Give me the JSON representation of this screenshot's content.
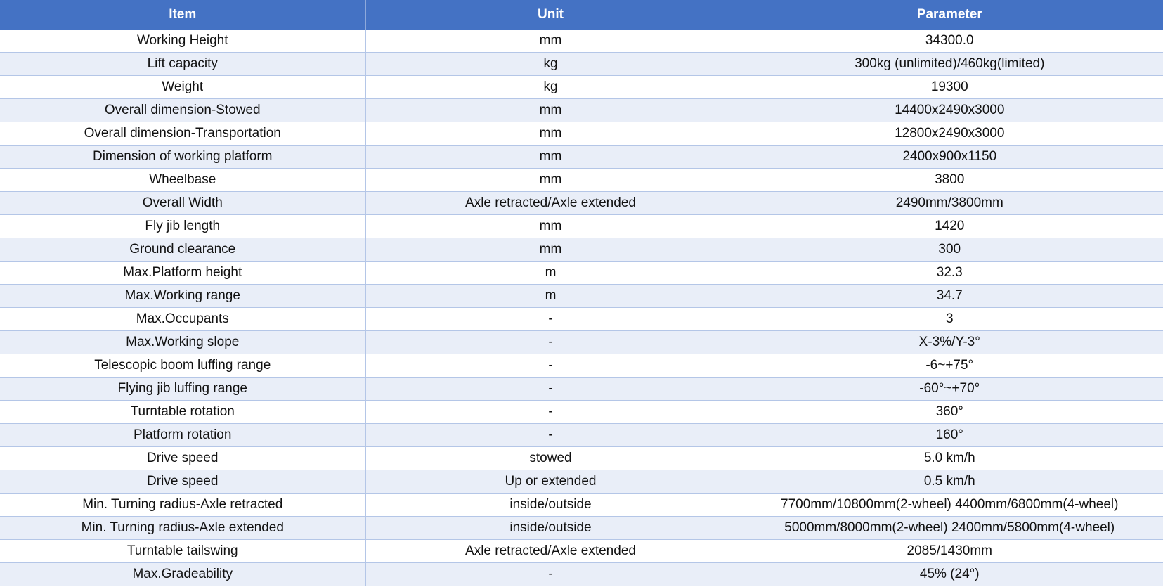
{
  "table": {
    "headers": [
      "Item",
      "Unit",
      "Parameter"
    ],
    "rows": [
      [
        "Working Height",
        "mm",
        "34300.0"
      ],
      [
        "Lift capacity",
        "kg",
        "300kg (unlimited)/460kg(limited)"
      ],
      [
        "Weight",
        "kg",
        "19300"
      ],
      [
        "Overall dimension-Stowed",
        "mm",
        "14400x2490x3000"
      ],
      [
        "Overall dimension-Transportation",
        "mm",
        "12800x2490x3000"
      ],
      [
        "Dimension of working platform",
        "mm",
        "2400x900x1150"
      ],
      [
        "Wheelbase",
        "mm",
        "3800"
      ],
      [
        "Overall Width",
        "Axle retracted/Axle extended",
        "2490mm/3800mm"
      ],
      [
        "Fly jib length",
        "mm",
        "1420"
      ],
      [
        "Ground clearance",
        "mm",
        "300"
      ],
      [
        "Max.Platform height",
        "m",
        "32.3"
      ],
      [
        "Max.Working range",
        "m",
        "34.7"
      ],
      [
        "Max.Occupants",
        "-",
        "3"
      ],
      [
        "Max.Working slope",
        "-",
        "X-3%/Y-3°"
      ],
      [
        "Telescopic boom luffing range",
        "-",
        "-6~+75°"
      ],
      [
        "Flying jib luffing range",
        "-",
        "-60°~+70°"
      ],
      [
        "Turntable rotation",
        "-",
        "360°"
      ],
      [
        "Platform rotation",
        "-",
        "160°"
      ],
      [
        "Drive speed",
        "stowed",
        "5.0 km/h"
      ],
      [
        "Drive speed",
        "Up or extended",
        "0.5 km/h"
      ],
      [
        "Min. Turning radius-Axle retracted",
        "inside/outside",
        "7700mm/10800mm(2-wheel) 4400mm/6800mm(4-wheel)"
      ],
      [
        "Min. Turning radius-Axle extended",
        "inside/outside",
        "5000mm/8000mm(2-wheel) 2400mm/5800mm(4-wheel)"
      ],
      [
        "Turntable tailswing",
        "Axle retracted/Axle extended",
        "2085/1430mm"
      ],
      [
        "Max.Gradeability",
        "-",
        "45% (24°)"
      ]
    ]
  },
  "colors": {
    "header_bg": "#4472c4",
    "header_text": "#ffffff",
    "band_row_bg": "#e9eef8",
    "grid_line": "#b4c6e7"
  }
}
